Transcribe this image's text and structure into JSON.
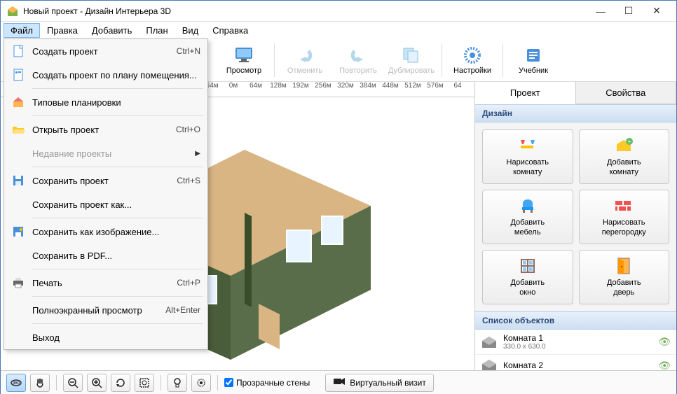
{
  "window": {
    "title": "Новый проект - Дизайн Интерьера 3D"
  },
  "menubar": {
    "file": "Файл",
    "edit": "Правка",
    "add": "Добавить",
    "plan": "План",
    "view": "Вид",
    "help": "Справка"
  },
  "file_menu": {
    "create_project": "Создать проект",
    "create_project_sc": "Ctrl+N",
    "create_from_plan": "Создать проект по плану помещения...",
    "typical_layouts": "Типовые планировки",
    "open_project": "Открыть проект",
    "open_project_sc": "Ctrl+O",
    "recent": "Недавние проекты",
    "save_project": "Сохранить проект",
    "save_project_sc": "Ctrl+S",
    "save_as": "Сохранить проект как...",
    "save_image": "Сохранить как изображение...",
    "save_pdf": "Сохранить в  PDF...",
    "print": "Печать",
    "print_sc": "Ctrl+P",
    "fullscreen": "Полноэкранный просмотр",
    "fullscreen_sc": "Alt+Enter",
    "exit": "Выход"
  },
  "toolbar": {
    "preview": "Просмотр",
    "undo": "Отменить",
    "redo": "Повторить",
    "duplicate": "Дублировать",
    "settings": "Настройки",
    "tutorial": "Учебник"
  },
  "ruler": {
    "ticks": [
      "-64м",
      "0м",
      "64м",
      "128м",
      "192м",
      "256м",
      "320м",
      "384м",
      "448м",
      "512м",
      "576м",
      "64"
    ]
  },
  "tabs": {
    "project": "Проект",
    "properties": "Свойства"
  },
  "sections": {
    "design": "Дизайн",
    "objects": "Список объектов"
  },
  "design_buttons": {
    "draw_room1": "Нарисовать",
    "draw_room2": "комнату",
    "add_room1": "Добавить",
    "add_room2": "комнату",
    "add_furn1": "Добавить",
    "add_furn2": "мебель",
    "draw_wall1": "Нарисовать",
    "draw_wall2": "перегородку",
    "add_win1": "Добавить",
    "add_win2": "окно",
    "add_door1": "Добавить",
    "add_door2": "дверь"
  },
  "objects": {
    "room1": "Комната 1",
    "room1_dim": "330.0 x 630.0",
    "room2": "Комната 2"
  },
  "bottombar": {
    "transparent_walls": "Прозрачные стены",
    "virtual_visit": "Виртуальный визит"
  }
}
